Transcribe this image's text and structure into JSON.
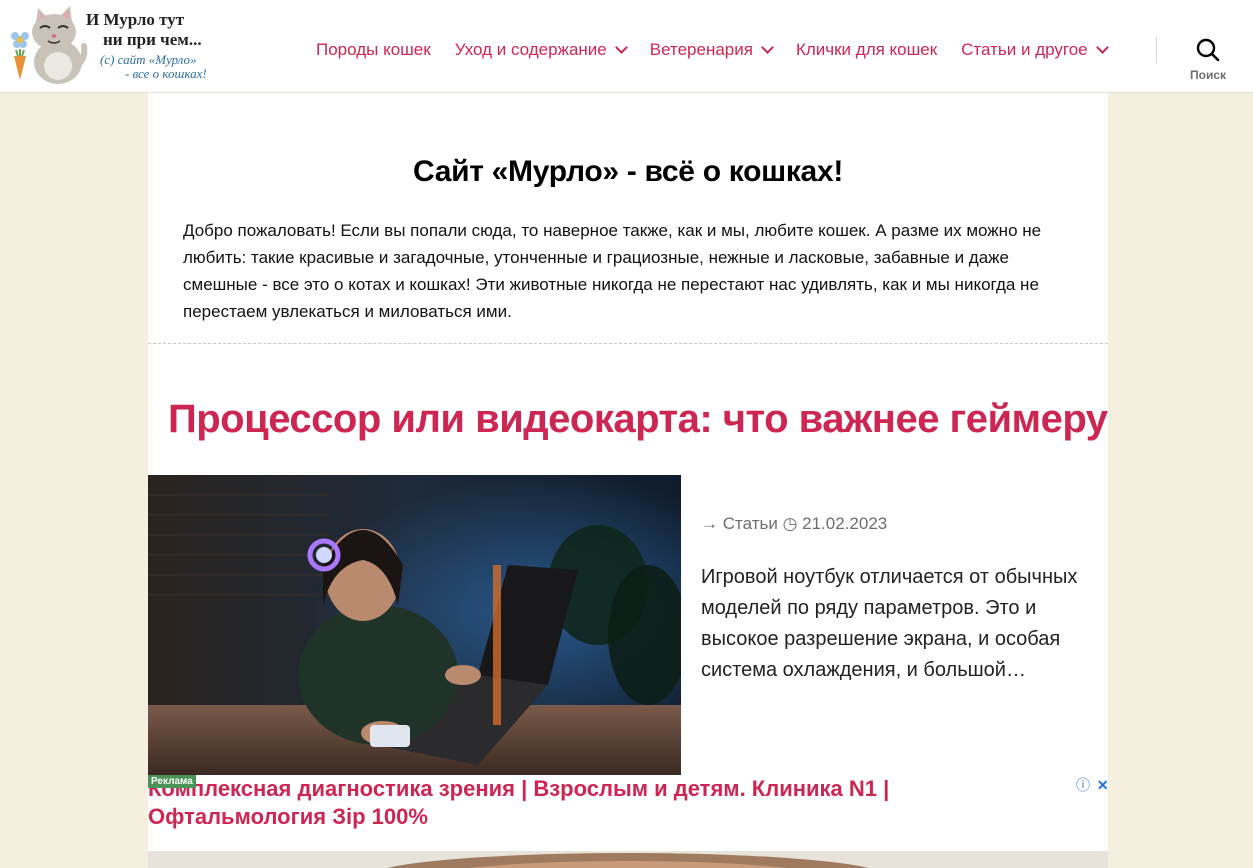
{
  "logo": {
    "line1": "И Мурло тут",
    "line2": "ни при чем...",
    "line3": "(с) сайт «Мурло»",
    "line4": "- все о кошках!"
  },
  "nav": {
    "items": [
      {
        "label": "Породы кошек"
      },
      {
        "label": "Уход и содержание"
      },
      {
        "label": "Ветеренария"
      },
      {
        "label": "Клички для кошек"
      },
      {
        "label": "Статьи и другое"
      }
    ],
    "search_label": "Поиск"
  },
  "intro": {
    "title": "Сайт «Мурло» - всё о кошках!",
    "text": "Добро пожаловать! Если вы попали сюда, то наверное также, как и мы, любите кошек. А разме их можно не любить: такие красивые и загадочные, утонченные и грациозные, нежные и ласковые, забавные и даже смешные - все это о котах и кошках! Эти животные никогда не перестают нас удивлять, как и мы никогда не перестаем увлекаться и миловаться ими."
  },
  "post": {
    "title": "Процессор или видеокарта: что важнее геймеру",
    "category_arrow": "→",
    "category": "Статьи",
    "date_icon": "◷",
    "date": "21.02.2023",
    "excerpt": "Игровой ноутбук отличается от обычных моделей по ряду параметров. Это и высокое разрешение экрана, и особая система охлаждения, и большой…"
  },
  "ad": {
    "badge": "Реклама",
    "text": "Комплексная диагностика зрения | Взрослым и детям. Клиника N1 | Офтальмология Зір 100%",
    "info_icon": "ⓘ",
    "close_icon": "✕"
  },
  "icons": {
    "search": "search-icon",
    "chevron": "chevron-down-icon",
    "clock": "clock-icon"
  },
  "colors": {
    "accent": "#cd2653",
    "background": "#f5efe0",
    "meta": "#6d6d6d"
  }
}
